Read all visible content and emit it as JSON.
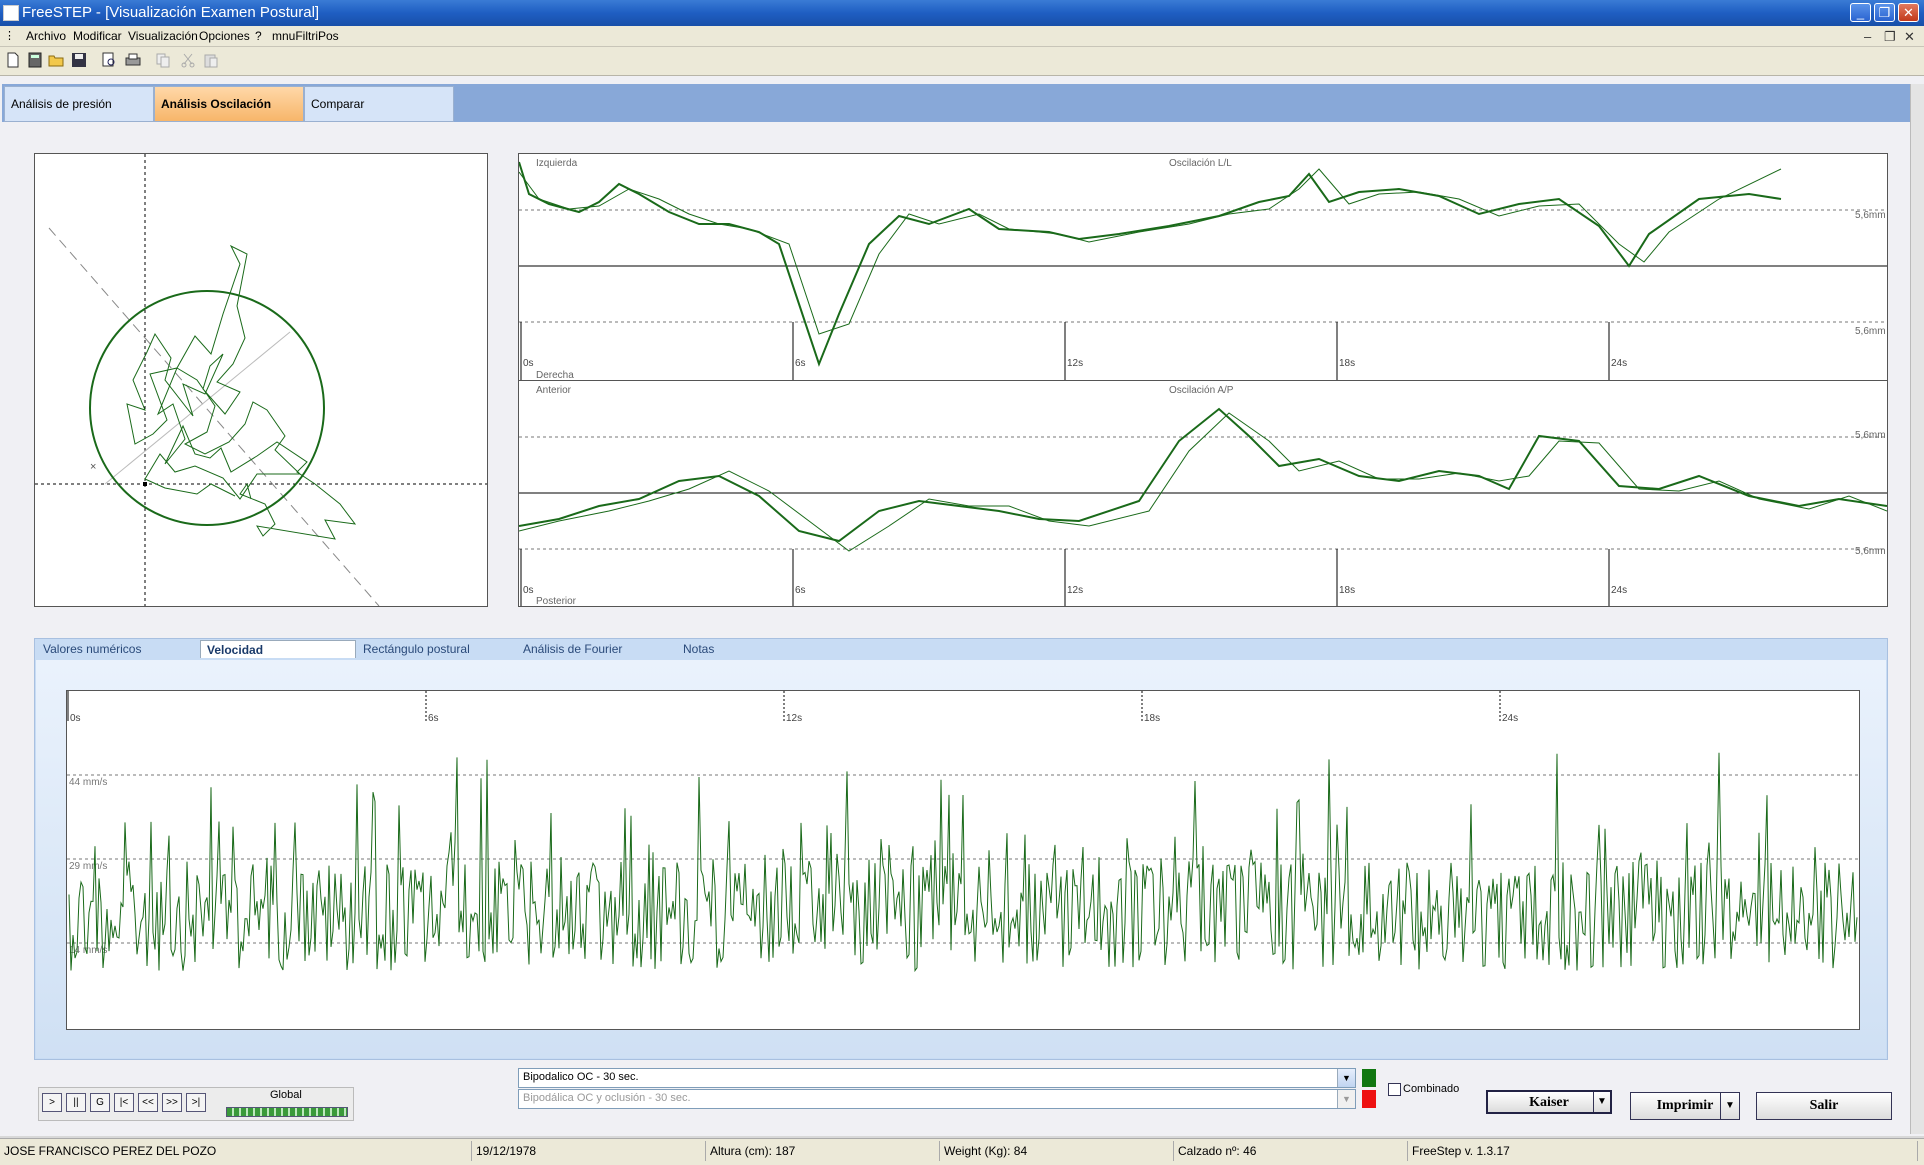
{
  "window": {
    "title": "FreeSTEP - [Visualización Examen Postural]"
  },
  "menu": [
    "Archivo",
    "Modificar",
    "Visualización",
    "Opciones",
    "?",
    "mnuFiltriPos"
  ],
  "tabs_top": [
    "Análisis de presión",
    "Análisis Oscilación",
    "Comparar"
  ],
  "active_tab_top": "Análisis Oscilación",
  "ll_chart": {
    "title": "Oscilación L/L",
    "top_label": "Izquierda",
    "bottom_label": "Derecha",
    "scale_top": "5,6mm",
    "scale_bottom": "5,6mm",
    "ticks": [
      "0s",
      "6s",
      "12s",
      "18s",
      "24s"
    ]
  },
  "ap_chart": {
    "title": "Oscilación A/P",
    "top_label": "Anterior",
    "bottom_label": "Posterior",
    "scale_top": "5,6mm",
    "scale_bottom": "5,6mm",
    "ticks": [
      "0s",
      "6s",
      "12s",
      "18s",
      "24s"
    ]
  },
  "tabs_bottom": [
    "Valores numéricos",
    "Velocidad",
    "Rectángulo postural",
    "Análisis de Fourier",
    "Notas"
  ],
  "active_tab_bottom": "Velocidad",
  "velocity_chart": {
    "ticks": [
      "0s",
      "6s",
      "12s",
      "18s",
      "24s"
    ],
    "levels": [
      "44 mm/s",
      "29 mm/s",
      "14 mm/s"
    ]
  },
  "controls": {
    "nav_buttons": [
      ">",
      "||",
      "G",
      "|<",
      "<<",
      ">>",
      ">|"
    ],
    "global_label": "Global",
    "exam1": "Bipodalico OC - 30 sec.",
    "exam2": "Bipodálica OC y oclusión - 30 sec.",
    "combinado": "Combinado",
    "filter": "Kaiser",
    "print": "Imprimir",
    "exit": "Salir"
  },
  "colors": {
    "exam1": "#117711",
    "exam2": "#ee1111",
    "trace": "#116611"
  },
  "status": {
    "name": "JOSE FRANCISCO PEREZ DEL POZO",
    "dob": "19/12/1978",
    "height": "Altura (cm): 187",
    "weight": "Weight (Kg): 84",
    "shoe": "Calzado nº: 46",
    "version": "FreeStep v. 1.3.17"
  }
}
